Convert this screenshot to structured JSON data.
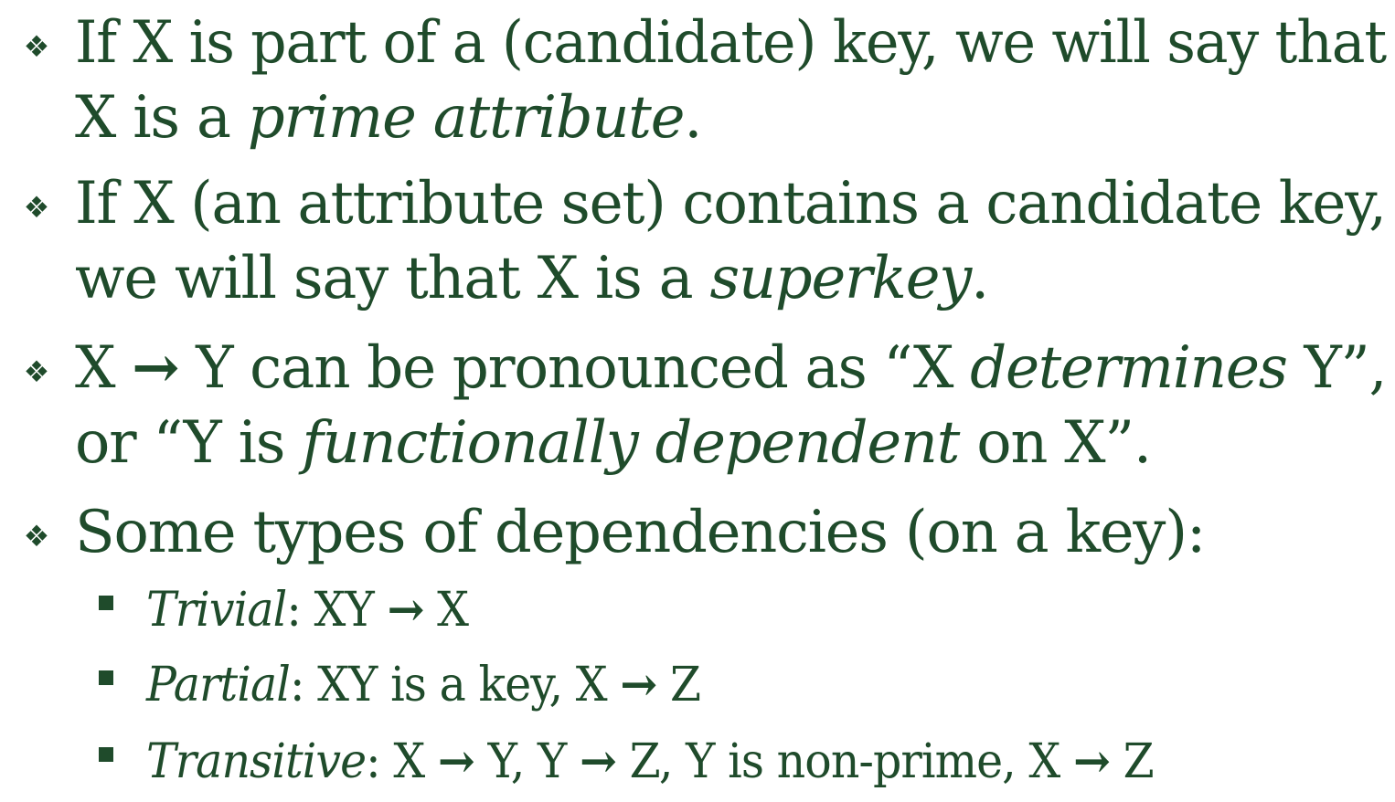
{
  "slide": {
    "bullets": [
      {
        "line1": "If X is part of a (candidate) key, we will say that",
        "line2_pre": "X is a ",
        "line2_em": "prime attribute",
        "line2_post": "."
      },
      {
        "line1": "If X (an attribute set) contains a candidate key,",
        "line2_pre": "we will say that X is a ",
        "line2_em": "superkey",
        "line2_post": "."
      },
      {
        "line1_pre": "X ",
        "line1_arrow": "→",
        "line1_mid": " Y can be pronounced as “X ",
        "line1_em": "determines",
        "line1_post": " Y”,",
        "line2_pre": "or “Y is ",
        "line2_em": "functionally dependent",
        "line2_post": " on X”."
      },
      {
        "line1": "Some types of dependencies (on a key):"
      }
    ],
    "sub_bullets": [
      {
        "label": "Trivial",
        "text_pre": ":  XY ",
        "arrow": "→",
        "text_post": " X"
      },
      {
        "label": "Partial",
        "text_pre": ":  XY is a key, X ",
        "arrow": "→",
        "text_post": " Z"
      },
      {
        "label": "Transitive",
        "text_pre": ":  X ",
        "arrow1": "→",
        "text_mid1": " Y, Y ",
        "arrow2": "→",
        "text_mid2": " Z, Y is non-prime, X ",
        "arrow3": "→",
        "text_post": " Z"
      }
    ],
    "markers": {
      "bullet_icon": "diamond-cluster-bullet-icon",
      "sub_bullet_icon": "square-bullet-icon",
      "bullet_glyph": "❖"
    },
    "colors": {
      "text": "#1f4b2b",
      "background": "#ffffff"
    }
  }
}
